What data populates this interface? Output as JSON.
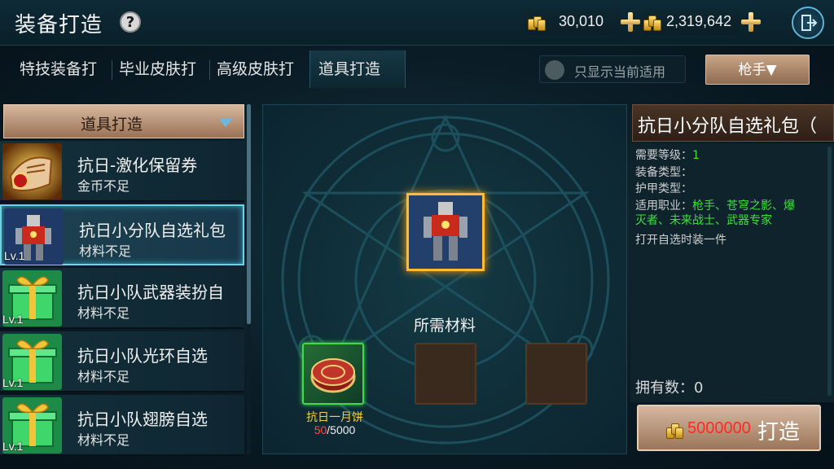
{
  "header": {
    "title": "装备打造",
    "help_symbol": "?",
    "gold_value": "30,010",
    "gold_icon": "gold-bars-icon",
    "premium_value": "2,319,642",
    "premium_icon": "gold-pile-icon",
    "exit_icon": "exit-door-icon"
  },
  "tabs": [
    {
      "label": "特技装备打"
    },
    {
      "label": "毕业皮肤打"
    },
    {
      "label": "高级皮肤打"
    },
    {
      "label": "道具打造",
      "active": true
    }
  ],
  "filter": {
    "label": "只显示当前适用",
    "checked": false
  },
  "class_dropdown": {
    "label": "枪手▼"
  },
  "list": {
    "header_label": "道具打造",
    "items": [
      {
        "name": "抗日-激化保留券",
        "status": "金币不足",
        "level": "",
        "icon": "scroll-ticket-icon"
      },
      {
        "name": "抗日小分队自选礼包",
        "status": "材料不足",
        "level": "Lv.1",
        "icon": "mech-warrior-icon",
        "selected": true
      },
      {
        "name": "抗日小队武器装扮自",
        "status": "材料不足",
        "level": "Lv.1",
        "icon": "gift-box-icon"
      },
      {
        "name": "抗日小队光环自选",
        "status": "材料不足",
        "level": "Lv.1",
        "icon": "gift-box-icon"
      },
      {
        "name": "抗日小队翅膀自选",
        "status": "材料不足",
        "level": "Lv.1",
        "icon": "gift-box-icon"
      }
    ]
  },
  "center": {
    "result_icon": "mech-warrior-icon",
    "materials_label": "所需材料",
    "material": {
      "name": "抗日一月饼",
      "have": "50",
      "need": "/5000",
      "icon": "mooncake-icon"
    }
  },
  "detail": {
    "title": "抗日小分队自选礼包（",
    "level_label": "需要等级：",
    "level_value": "1",
    "equip_type_label": "装备类型：",
    "armor_type_label": "护甲类型：",
    "class_label": "适用职业：",
    "class_value_1": "枪手、苍穹之影、爆",
    "class_value_2": "灭者、未来战士、武器专家",
    "description": "打开自选时装一件",
    "owned_label": "拥有数：0",
    "craft_cost": "5000000",
    "craft_label": "打造"
  },
  "colors": {
    "accent_cyan": "#6fd3e8",
    "gold": "#ffbb34",
    "warning_red": "#ff2a22",
    "material_name": "#ffcf3a",
    "class_green": "#3fe03f"
  }
}
